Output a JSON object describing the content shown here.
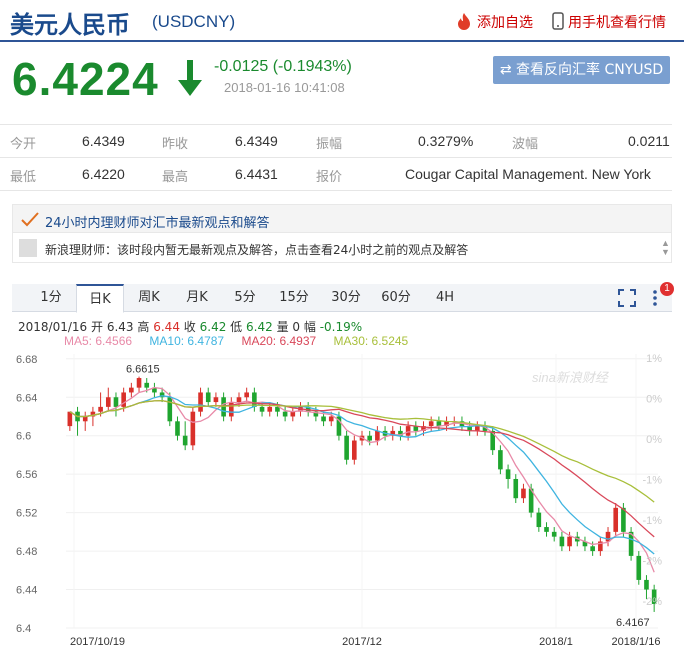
{
  "header": {
    "name_cn": "美元人民币",
    "code": "(USDCNY)",
    "add_watch": "添加自选",
    "mobile": "用手机查看行情"
  },
  "quote": {
    "price": "6.4224",
    "change": "-0.0125 (-0.1943%)",
    "time": "2018-01-16 10:41:08",
    "reverse_btn": "⇄ 查看反向汇率 CNYUSD",
    "color": "#1a8a2e"
  },
  "stats": {
    "open_label": "今开",
    "open": "6.4349",
    "prev_label": "昨收",
    "prev": "6.4349",
    "amp_label": "振幅",
    "amp": "0.3279%",
    "wave_label": "波幅",
    "wave": "0.0211",
    "low_label": "最低",
    "low": "6.4220",
    "high_label": "最高",
    "high": "6.4431",
    "quote_label": "报价",
    "quote_by": "Cougar Capital Management. New York"
  },
  "advice": {
    "title": "24小时内理财师对汇市最新观点和解答",
    "text": "新浪理财师：该时段内暂无最新观点及解答，点击查看24小时之前的观点及解答"
  },
  "tabs": [
    "1分",
    "日K",
    "周K",
    "月K",
    "5分",
    "15分",
    "30分",
    "60分",
    "4H"
  ],
  "active_tab": "日K",
  "badge": "1",
  "info": {
    "date": "2018/01/16",
    "open_l": "开",
    "open": "6.43",
    "high_l": "高",
    "high": "6.44",
    "close_l": "收",
    "close": "6.42",
    "low_l": "低",
    "low": "6.42",
    "vol_l": "量",
    "vol": "0",
    "pct_l": "幅",
    "pct": "-0.19%",
    "ma5": "MA5: 6.4566",
    "ma10": "MA10: 6.4787",
    "ma20": "MA20: 6.4937",
    "ma30": "MA30: 6.5245"
  },
  "colors": {
    "ma5": "#e88aa8",
    "ma10": "#3fb4e0",
    "ma20": "#d9485a",
    "ma30": "#a8bf3a",
    "up": "#d9302a",
    "down": "#1fa52f"
  },
  "chart_data": {
    "type": "candlestick",
    "watermark": "sina新浪财经",
    "y_ticks": [
      "6.68",
      "6.64",
      "6.6",
      "6.56",
      "6.52",
      "6.48",
      "6.44",
      "6.4"
    ],
    "pct_ticks": [
      "1%",
      "0%",
      "0%",
      "-1%",
      "-1%",
      "-2%",
      "-2%"
    ],
    "x_ticks": [
      "2017/10/19",
      "2017/12",
      "2018/1",
      "2018/1/16"
    ],
    "max_label": "6.6615",
    "min_label": "6.4167",
    "ylim": [
      6.4,
      6.685
    ],
    "candles": [
      [
        6.61,
        6.625,
        6.62,
        6.605
      ],
      [
        6.625,
        6.615,
        6.63,
        6.6
      ],
      [
        6.615,
        6.62,
        6.625,
        6.605
      ],
      [
        6.62,
        6.625,
        6.63,
        6.61
      ],
      [
        6.625,
        6.63,
        6.645,
        6.62
      ],
      [
        6.63,
        6.64,
        6.65,
        6.625
      ],
      [
        6.64,
        6.63,
        6.645,
        6.62
      ],
      [
        6.63,
        6.645,
        6.65,
        6.625
      ],
      [
        6.645,
        6.65,
        6.655,
        6.64
      ],
      [
        6.65,
        6.66,
        6.6615,
        6.645
      ],
      [
        6.655,
        6.65,
        6.66,
        6.645
      ],
      [
        6.65,
        6.645,
        6.655,
        6.64
      ],
      [
        6.645,
        6.64,
        6.65,
        6.635
      ],
      [
        6.64,
        6.615,
        6.645,
        6.61
      ],
      [
        6.615,
        6.6,
        6.62,
        6.595
      ],
      [
        6.6,
        6.59,
        6.615,
        6.585
      ],
      [
        6.59,
        6.625,
        6.63,
        6.585
      ],
      [
        6.625,
        6.645,
        6.65,
        6.62
      ],
      [
        6.645,
        6.635,
        6.65,
        6.63
      ],
      [
        6.635,
        6.64,
        6.645,
        6.63
      ],
      [
        6.64,
        6.62,
        6.645,
        6.615
      ],
      [
        6.62,
        6.635,
        6.64,
        6.615
      ],
      [
        6.635,
        6.64,
        6.645,
        6.63
      ],
      [
        6.64,
        6.645,
        6.65,
        6.635
      ],
      [
        6.645,
        6.63,
        6.65,
        6.625
      ],
      [
        6.63,
        6.625,
        6.635,
        6.62
      ],
      [
        6.625,
        6.63,
        6.635,
        6.62
      ],
      [
        6.63,
        6.625,
        6.635,
        6.62
      ],
      [
        6.625,
        6.62,
        6.63,
        6.615
      ],
      [
        6.62,
        6.625,
        6.63,
        6.615
      ],
      [
        6.625,
        6.63,
        6.635,
        6.62
      ],
      [
        6.63,
        6.625,
        6.635,
        6.62
      ],
      [
        6.625,
        6.62,
        6.63,
        6.615
      ],
      [
        6.62,
        6.615,
        6.625,
        6.61
      ],
      [
        6.615,
        6.62,
        6.625,
        6.61
      ],
      [
        6.62,
        6.6,
        6.625,
        6.595
      ],
      [
        6.6,
        6.575,
        6.605,
        6.57
      ],
      [
        6.575,
        6.595,
        6.6,
        6.57
      ],
      [
        6.595,
        6.6,
        6.605,
        6.59
      ],
      [
        6.6,
        6.595,
        6.605,
        6.59
      ],
      [
        6.595,
        6.605,
        6.61,
        6.59
      ],
      [
        6.605,
        6.6,
        6.61,
        6.595
      ],
      [
        6.6,
        6.605,
        6.61,
        6.595
      ],
      [
        6.605,
        6.6,
        6.61,
        6.595
      ],
      [
        6.6,
        6.61,
        6.615,
        6.595
      ],
      [
        6.61,
        6.605,
        6.615,
        6.6
      ],
      [
        6.605,
        6.61,
        6.615,
        6.6
      ],
      [
        6.61,
        6.615,
        6.62,
        6.605
      ],
      [
        6.615,
        6.61,
        6.62,
        6.605
      ],
      [
        6.61,
        6.615,
        6.62,
        6.605
      ],
      [
        6.615,
        6.615,
        6.62,
        6.61
      ],
      [
        6.615,
        6.61,
        6.62,
        6.605
      ],
      [
        6.61,
        6.605,
        6.615,
        6.6
      ],
      [
        6.605,
        6.61,
        6.615,
        6.6
      ],
      [
        6.61,
        6.605,
        6.615,
        6.6
      ],
      [
        6.605,
        6.585,
        6.61,
        6.58
      ],
      [
        6.585,
        6.565,
        6.59,
        6.56
      ],
      [
        6.565,
        6.555,
        6.57,
        6.545
      ],
      [
        6.555,
        6.535,
        6.56,
        6.53
      ],
      [
        6.535,
        6.545,
        6.55,
        6.53
      ],
      [
        6.545,
        6.52,
        6.55,
        6.515
      ],
      [
        6.52,
        6.505,
        6.525,
        6.5
      ],
      [
        6.505,
        6.5,
        6.51,
        6.495
      ],
      [
        6.5,
        6.495,
        6.505,
        6.49
      ],
      [
        6.495,
        6.485,
        6.5,
        6.48
      ],
      [
        6.485,
        6.495,
        6.5,
        6.48
      ],
      [
        6.495,
        6.49,
        6.5,
        6.485
      ],
      [
        6.49,
        6.485,
        6.495,
        6.48
      ],
      [
        6.485,
        6.48,
        6.49,
        6.475
      ],
      [
        6.48,
        6.49,
        6.495,
        6.475
      ],
      [
        6.49,
        6.5,
        6.505,
        6.485
      ],
      [
        6.5,
        6.525,
        6.53,
        6.495
      ],
      [
        6.525,
        6.5,
        6.53,
        6.495
      ],
      [
        6.5,
        6.475,
        6.505,
        6.47
      ],
      [
        6.475,
        6.45,
        6.48,
        6.445
      ],
      [
        6.45,
        6.44,
        6.455,
        6.43
      ],
      [
        6.44,
        6.425,
        6.445,
        6.4167
      ]
    ]
  }
}
